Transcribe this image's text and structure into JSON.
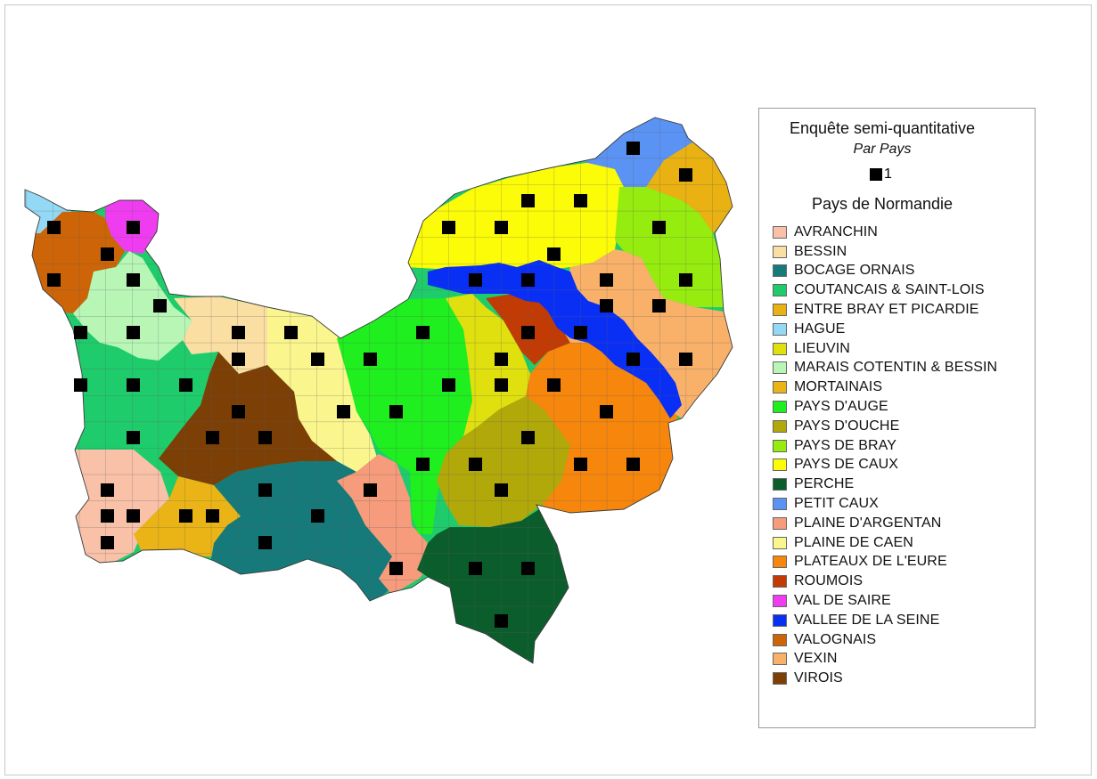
{
  "legend": {
    "title": "Enquête semi-quantitative",
    "subtitle": "Par Pays",
    "symbol_value": "1",
    "section_title": "Pays de Normandie"
  },
  "pays": [
    {
      "label": "AVRANCHIN",
      "color": "#f8c1a8"
    },
    {
      "label": "BESSIN",
      "color": "#fbdfa2"
    },
    {
      "label": "BOCAGE ORNAIS",
      "color": "#167a7b"
    },
    {
      "label": "COUTANCAIS & SAINT-LOIS",
      "color": "#1fcc6c"
    },
    {
      "label": "ENTRE BRAY ET PICARDIE",
      "color": "#e9b212"
    },
    {
      "label": "HAGUE",
      "color": "#93d9f6"
    },
    {
      "label": "LIEUVIN",
      "color": "#dfe00e"
    },
    {
      "label": "MARAIS COTENTIN & BESSIN",
      "color": "#b8f6b6"
    },
    {
      "label": "MORTAINAIS",
      "color": "#eab416"
    },
    {
      "label": "PAYS D'AUGE",
      "color": "#1fee1f"
    },
    {
      "label": "PAYS D'OUCHE",
      "color": "#b1a80a"
    },
    {
      "label": "PAYS DE BRAY",
      "color": "#96ec0e"
    },
    {
      "label": "PAYS DE CAUX",
      "color": "#fcfc08"
    },
    {
      "label": "PERCHE",
      "color": "#0c5d2c"
    },
    {
      "label": "PETIT CAUX",
      "color": "#5b93f4"
    },
    {
      "label": "PLAINE D'ARGENTAN",
      "color": "#f69b7b"
    },
    {
      "label": "PLAINE DE CAEN",
      "color": "#fbf58d"
    },
    {
      "label": "PLATEAUX DE L'EURE",
      "color": "#f7860d"
    },
    {
      "label": "ROUMOIS",
      "color": "#c23b05"
    },
    {
      "label": "VAL DE SAIRE",
      "color": "#f03cf0"
    },
    {
      "label": "VALLEE DE LA SEINE",
      "color": "#0a2ff4"
    },
    {
      "label": "VALOGNAIS",
      "color": "#cd6408"
    },
    {
      "label": "VEXIN",
      "color": "#f9b169"
    },
    {
      "label": "VIROIS",
      "color": "#7c3f06"
    }
  ]
}
